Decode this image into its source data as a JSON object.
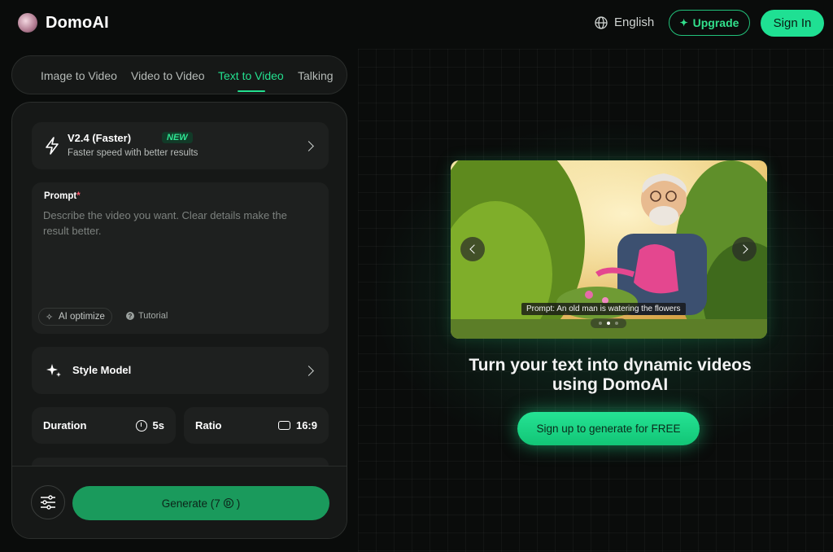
{
  "app": {
    "name": "DomoAI"
  },
  "header": {
    "language": "English",
    "upgrade_label": "Upgrade",
    "signin_label": "Sign In"
  },
  "tabs": [
    {
      "label": "Image to Video",
      "active": false
    },
    {
      "label": "Video to Video",
      "active": false
    },
    {
      "label": "Text to Video",
      "active": true
    },
    {
      "label": "Talking",
      "active": false
    }
  ],
  "model": {
    "title": "V2.4 (Faster)",
    "badge": "NEW",
    "subtitle": "Faster speed with better results"
  },
  "prompt": {
    "label": "Prompt",
    "required_mark": "*",
    "value": "",
    "placeholder": "Describe the video you want. Clear details make the result better.",
    "ai_optimize_label": "AI optimize",
    "tutorial_label": "Tutorial"
  },
  "style_model": {
    "label": "Style Model"
  },
  "duration": {
    "label": "Duration",
    "value": "5s"
  },
  "ratio": {
    "label": "Ratio",
    "value": "16:9"
  },
  "generate": {
    "label": "Generate (7",
    "suffix": ")"
  },
  "showcase": {
    "caption": "Prompt: An old man is watering the flowers",
    "slides": 3,
    "active_slide": 1
  },
  "hero": {
    "headline_line1": "Turn your text into dynamic videos",
    "headline_line2": "using DomoAI",
    "cta_label": "Sign up to generate for FREE"
  },
  "colors": {
    "accent": "#23e08f",
    "background": "#0b0d0c",
    "panel": "#161817",
    "card": "#1e201f",
    "generate": "#1a9a5c"
  }
}
